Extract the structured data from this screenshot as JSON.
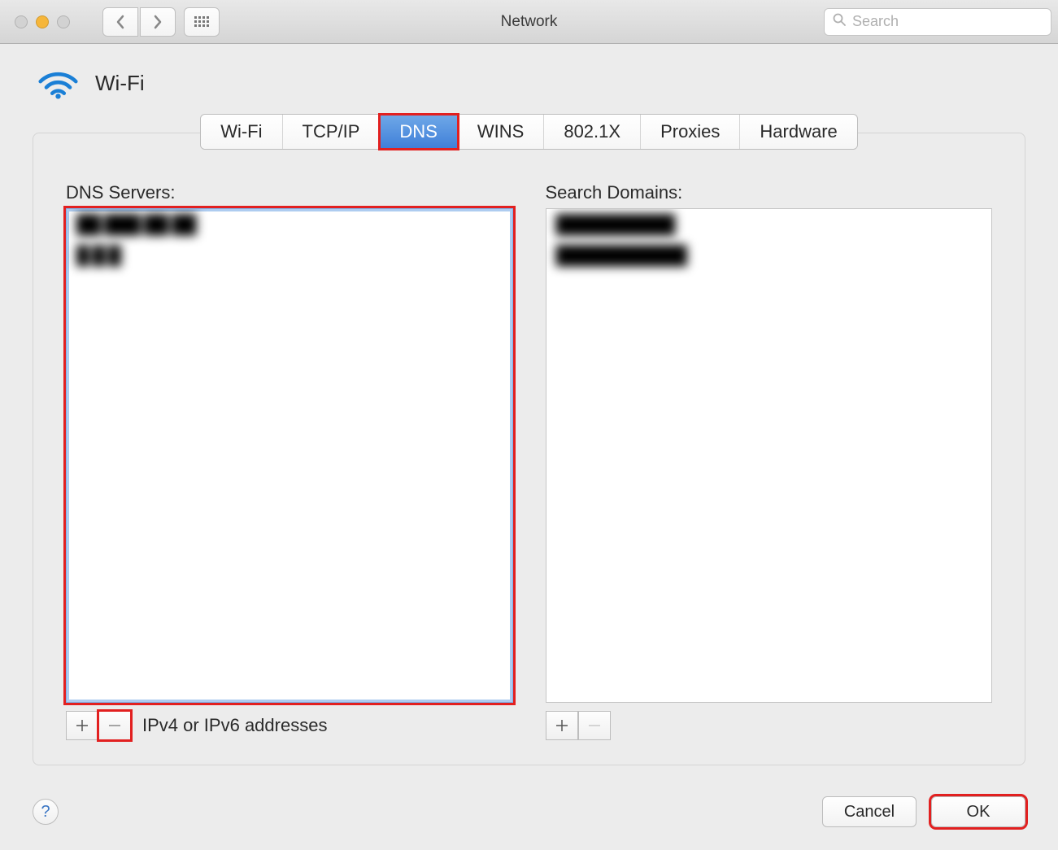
{
  "window": {
    "title": "Network",
    "search_placeholder": "Search"
  },
  "header": {
    "interface_name": "Wi-Fi"
  },
  "tabs": {
    "items": [
      "Wi-Fi",
      "TCP/IP",
      "DNS",
      "WINS",
      "802.1X",
      "Proxies",
      "Hardware"
    ],
    "active_index": 2
  },
  "dns_panel": {
    "servers_label": "DNS Servers:",
    "servers": [
      "██.███.██.██",
      "█.█.█"
    ],
    "servers_hint": "IPv4 or IPv6 addresses",
    "domains_label": "Search Domains:",
    "domains": [
      "██████████",
      "███████████"
    ]
  },
  "footer": {
    "cancel_label": "Cancel",
    "ok_label": "OK"
  }
}
